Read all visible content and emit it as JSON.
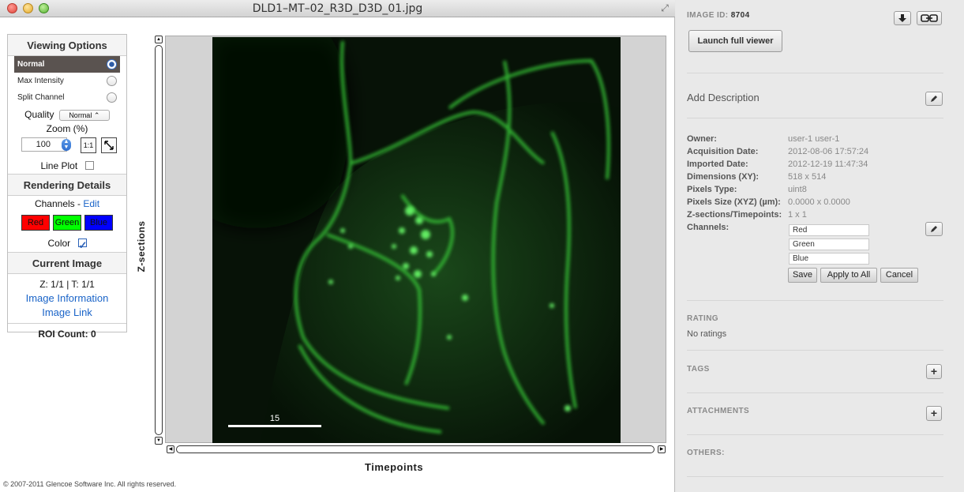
{
  "window": {
    "title": "DLD1–MT–02_R3D_D3D_01.jpg"
  },
  "viewing_options": {
    "title": "Viewing Options",
    "modes": [
      {
        "label": "Normal",
        "selected": true
      },
      {
        "label": "Max Intensity",
        "selected": false
      },
      {
        "label": "Split Channel",
        "selected": false
      }
    ],
    "quality_label": "Quality",
    "quality_value": "Normal",
    "zoom_label": "Zoom (%)",
    "zoom_value": "100",
    "zoom_fit_label": "1:1",
    "line_plot_label": "Line Plot",
    "line_plot_checked": false
  },
  "rendering": {
    "title": "Rendering Details",
    "channels_label": "Channels -",
    "edit_label": "Edit",
    "channels": [
      {
        "label": "Red",
        "color": "#ff0000"
      },
      {
        "label": "Green",
        "color": "#00ff00"
      },
      {
        "label": "Blue",
        "color": "#0000ff"
      }
    ],
    "color_label": "Color",
    "color_checked": true
  },
  "current_image": {
    "title": "Current Image",
    "z_t": "Z: 1/1 | T: 1/1",
    "info_link": "Image Information",
    "image_link": "Image Link",
    "roi_count": "ROI Count: 0"
  },
  "viewer": {
    "scale_bar_label": "15",
    "z_axis_label": "Z-sections",
    "t_axis_label": "Timepoints",
    "copyright": "© 2007-2011 Glencoe Software Inc. All rights reserved."
  },
  "metadata": {
    "image_id_label": "IMAGE ID:",
    "image_id": "8704",
    "launch_label": "Launch full viewer",
    "add_description": "Add Description",
    "rows": [
      {
        "key": "Owner:",
        "value": "user-1 user-1"
      },
      {
        "key": "Acquisition Date:",
        "value": "2012-08-06 17:57:24"
      },
      {
        "key": "Imported Date:",
        "value": "2012-12-19 11:47:34"
      },
      {
        "key": "Dimensions (XY):",
        "value": "518 x 514"
      },
      {
        "key": "Pixels Type:",
        "value": "uint8"
      },
      {
        "key": "Pixels Size (XYZ) (µm):",
        "value": "0.0000 x 0.0000"
      },
      {
        "key": "Z-sections/Timepoints:",
        "value": "1 x 1"
      }
    ],
    "channels_key": "Channels:",
    "channel_names": [
      "Red",
      "Green",
      "Blue"
    ],
    "save_label": "Save",
    "apply_all_label": "Apply to All",
    "cancel_label": "Cancel",
    "rating_label": "RATING",
    "rating_value": "No ratings",
    "tags_label": "TAGS",
    "attachments_label": "ATTACHMENTS",
    "others_label": "OTHERS:"
  },
  "colors": {
    "link": "#1a64c8",
    "selected_row": "#5a5350",
    "image_green": "#2bd12b"
  }
}
